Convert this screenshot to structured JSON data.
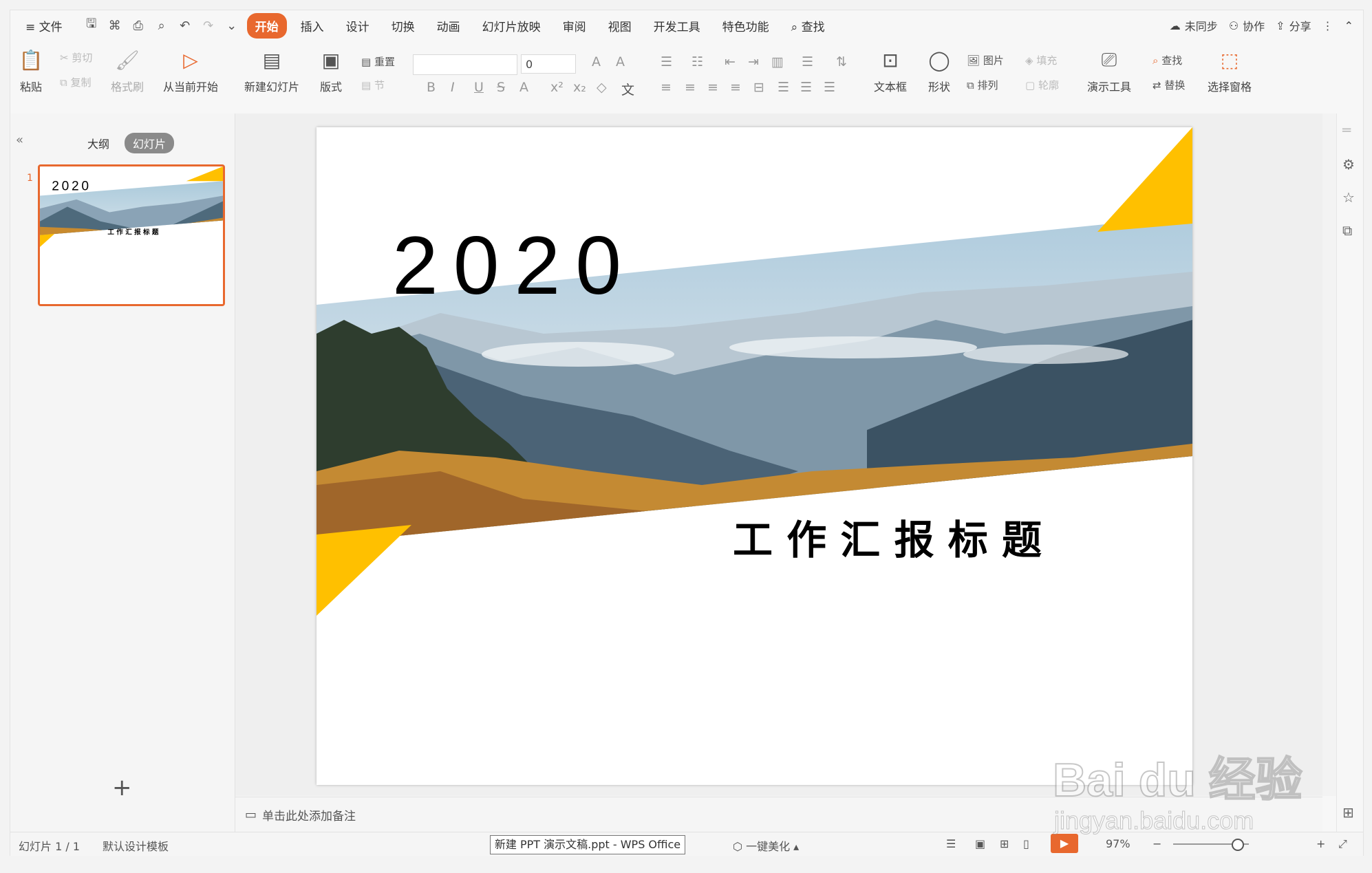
{
  "menubar": {
    "file": "文件",
    "tabs": [
      "开始",
      "插入",
      "设计",
      "切换",
      "动画",
      "幻灯片放映",
      "审阅",
      "视图",
      "开发工具",
      "特色功能"
    ],
    "active_tab": "开始",
    "search": "查找",
    "right": {
      "sync": "未同步",
      "collab": "协作",
      "share": "分享"
    }
  },
  "ribbon": {
    "paste": "粘贴",
    "cut": "剪切",
    "copy": "复制",
    "format_painter": "格式刷",
    "from_current": "从当前开始",
    "new_slide": "新建幻灯片",
    "layout": "版式",
    "reset": "重置",
    "section": "节",
    "font_size": "0",
    "textbox": "文本框",
    "shape": "形状",
    "picture": "图片",
    "fill": "填充",
    "arrange": "排列",
    "outline": "轮廓",
    "present_tools": "演示工具",
    "find": "查找",
    "replace": "替换",
    "select_pane": "选择窗格"
  },
  "left_panel": {
    "outline_tab": "大纲",
    "slides_tab": "幻灯片",
    "slide_number": "1"
  },
  "slide": {
    "year": "2020",
    "title": "工 作 汇 报 标 题",
    "thumb_year": "2020",
    "thumb_title": "工 作 汇 报 标 题"
  },
  "notes": {
    "placeholder": "单击此处添加备注"
  },
  "status": {
    "slide_info": "幻灯片 1 / 1",
    "template": "默认设计模板",
    "beautify": "一键美化",
    "zoom": "97%"
  },
  "taskbar": {
    "window_title": "新建 PPT 演示文稿.ppt - WPS Office"
  },
  "watermark": {
    "brand": "Bai du 经验",
    "url": "jingyan.baidu.com"
  },
  "colors": {
    "accent": "#e8682e",
    "slide_yellow": "#ffc000"
  }
}
